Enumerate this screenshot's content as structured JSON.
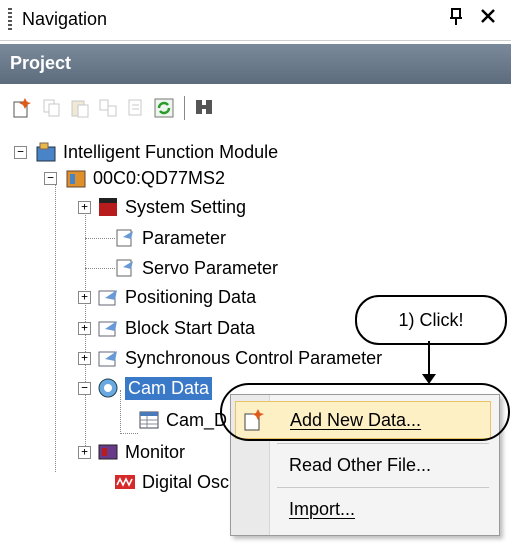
{
  "window": {
    "title": "Navigation",
    "pin_icon": "Ն",
    "close_icon": "✕"
  },
  "section": {
    "title": "Project"
  },
  "toolbar": {
    "icons": [
      "new-data-icon",
      "copy-icon",
      "paste-icon",
      "rename-icon",
      "properties-icon",
      "refresh-icon",
      "find-icon"
    ]
  },
  "tree": {
    "root": "Intelligent Function Module",
    "module": "00C0:QD77MS2",
    "items": [
      "System Setting",
      "Parameter",
      "Servo Parameter",
      "Positioning Data",
      "Block Start Data",
      "Synchronous Control Parameter",
      "Cam Data",
      "Cam_D",
      "Monitor",
      "Digital Osc"
    ]
  },
  "context_menu": {
    "items": [
      {
        "label": "Add New Data...",
        "highlighted": true,
        "underline": "A"
      },
      {
        "label": "Read Other File...",
        "highlighted": false
      },
      {
        "label": "Import...",
        "highlighted": false,
        "underline": "I"
      }
    ]
  },
  "annotation": {
    "callout": "1) Click!"
  },
  "colors": {
    "project_bar": "#6b7b8c",
    "selection": "#3a78c8",
    "menu_highlight": "#fdf0c4"
  }
}
